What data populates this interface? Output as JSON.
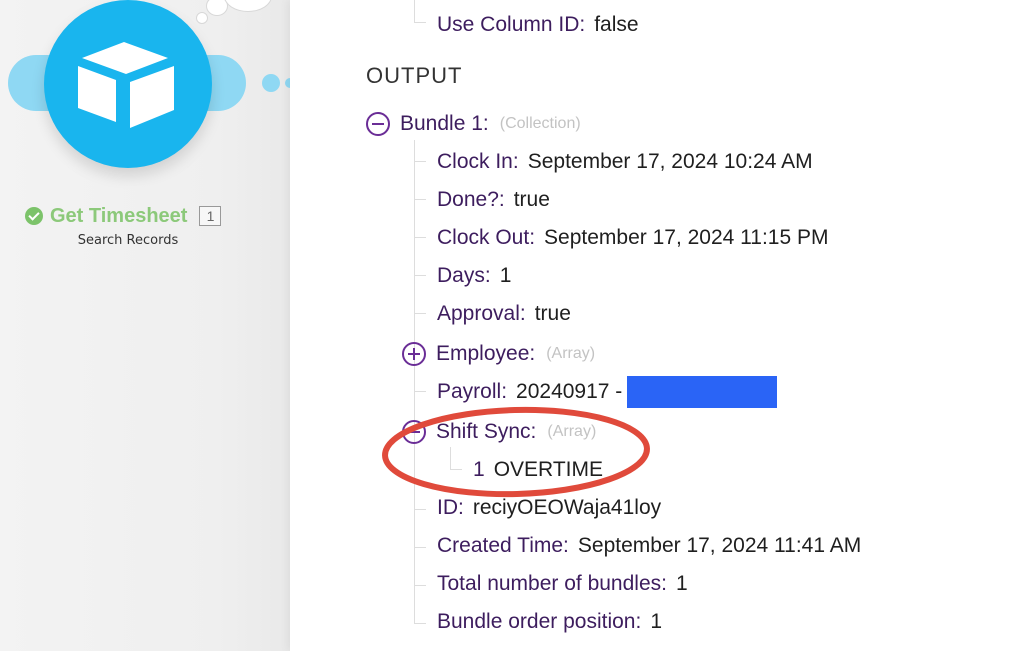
{
  "module": {
    "title": "Get Timesheet",
    "subtitle": "Search Records",
    "operation_badge": "1",
    "icon": "airtable-logo-icon",
    "status_icon": "check-circle-icon",
    "colors": {
      "circle": "#19b5ee",
      "title": "#8cc97a",
      "status": "#7cc36a"
    }
  },
  "panel": {
    "input_tail": {
      "key": "Use Column ID:",
      "value": "false"
    },
    "output_heading": "OUTPUT",
    "bundle": {
      "key": "Bundle 1:",
      "type": "(Collection)",
      "fields": [
        {
          "key": "Clock In:",
          "value": "September 17, 2024 10:24 AM"
        },
        {
          "key": "Done?:",
          "value": "true"
        },
        {
          "key": "Clock Out:",
          "value": "September 17, 2024 11:15 PM"
        },
        {
          "key": "Days:",
          "value": "1"
        },
        {
          "key": "Approval:",
          "value": "true"
        },
        {
          "key": "Employee:",
          "type": "(Array)"
        },
        {
          "key": "Payroll:",
          "value": "20240917 -"
        },
        {
          "key": "Shift Sync:",
          "type": "(Array)",
          "items": [
            {
              "index": "1",
              "value": "OVERTIME"
            }
          ]
        },
        {
          "key": "ID:",
          "value": "reciyOEOWaja41loy"
        },
        {
          "key": "Created Time:",
          "value": "September 17, 2024 11:41 AM"
        },
        {
          "key": "Total number of bundles:",
          "value": "1"
        },
        {
          "key": "Bundle order position:",
          "value": "1"
        }
      ]
    },
    "colors": {
      "key": "#3d1d5e",
      "toggle": "#6a2d96",
      "redaction": "#2a64f6",
      "highlight": "#e04a3b"
    }
  }
}
